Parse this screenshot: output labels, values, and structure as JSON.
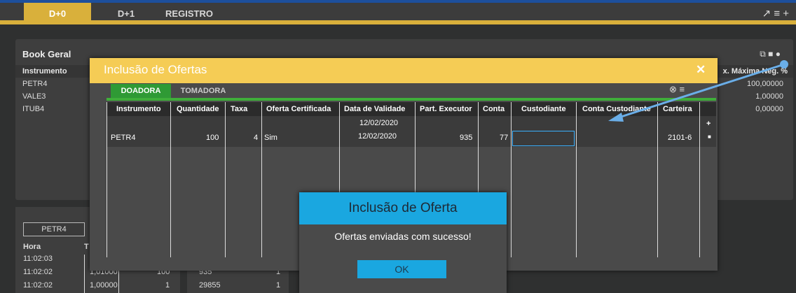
{
  "tabs": [
    "D+0",
    "D+1",
    "REGISTRO"
  ],
  "top_icons": "↗ ≡ +",
  "book": {
    "title": "Book Geral",
    "col_instrumento": "Instrumento",
    "col_right": "x. Máxima Neg. %",
    "rows": [
      {
        "instrumento": "PETR4",
        "value": "100,00000"
      },
      {
        "instrumento": "VALE3",
        "value": "1,00000"
      },
      {
        "instrumento": "ITUB4",
        "value": "0,00000"
      }
    ],
    "icons": "⧉ ■ ●"
  },
  "lower": {
    "instrument_button": "PETR4",
    "col_hora": "Hora",
    "col_t": "T",
    "rows": [
      {
        "hora": "11:02:03",
        "v1": "",
        "v2": "",
        "v3": "",
        "v4": ""
      },
      {
        "hora": "11:02:02",
        "v1": "1,01000",
        "v2": "100",
        "v3": "935",
        "v4": "1"
      },
      {
        "hora": "11:02:02",
        "v1": "1,00000",
        "v2": "1",
        "v3": "29855",
        "v4": "1"
      }
    ]
  },
  "modal": {
    "title": "Inclusão de Ofertas",
    "close": "✕",
    "tab_doadora": "DOADORA",
    "tab_tomadora": "TOMADORA",
    "mini_icons": "⊗ ≡",
    "headers": [
      "Instrumento",
      "Quantidade",
      "Taxa",
      "Oferta Certificada",
      "Data de Validade",
      "Part. Executor",
      "Conta",
      "Custodiante",
      "Conta Custodiante",
      "Carteira"
    ],
    "default_date": "12/02/2020",
    "add_symbol": "+",
    "row": {
      "instrumento": "PETR4",
      "quantidade": "100",
      "taxa": "4",
      "oferta_certificada": "Sim",
      "data_validade": "12/02/2020",
      "part_executor": "935",
      "conta": "77",
      "custodiante": "",
      "conta_custodiante": "",
      "carteira": "2101-6",
      "remove_symbol": "■"
    }
  },
  "dialog": {
    "title": "Inclusão de Oferta",
    "message": "Ofertas enviadas com sucesso!",
    "ok": "OK"
  },
  "colors": {
    "accent_gold": "#d9b03b",
    "modal_header": "#f5cc55",
    "tab_green": "#2f9a35",
    "dialog_blue": "#1aa7e0",
    "arrow_blue": "#6aaee8"
  }
}
